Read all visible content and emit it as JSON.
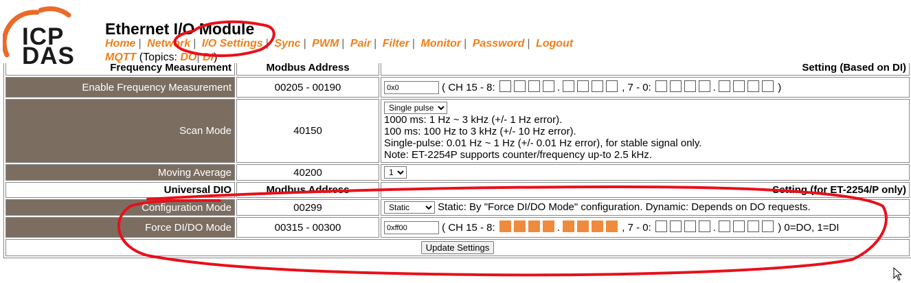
{
  "header": {
    "logo_top": "ICP",
    "logo_bottom": "DAS",
    "title": "Ethernet I/O Module",
    "nav": [
      "Home",
      "Network",
      "I/O Settings",
      "Sync",
      "PWM",
      "Pair",
      "Filter",
      "Monitor",
      "Password",
      "Logout"
    ],
    "mqtt": {
      "label": "MQTT",
      "topics_prefix": "(Topics:",
      "do": "DO",
      "di": "DI",
      "suffix": ")"
    }
  },
  "freq_header": {
    "label": "Frequency Measurement",
    "addr": "Modbus Address",
    "setting": "Setting (Based on DI)"
  },
  "rows": {
    "enable_freq": {
      "label": "Enable Frequency Measurement",
      "addr": "00205 - 00190",
      "value": "0x0",
      "ch_hi": "( CH 15 - 8:",
      "ch_lo": ", 7 - 0:",
      "tail": ")"
    },
    "scan_mode": {
      "label": "Scan Mode",
      "addr": "40150",
      "selected": "Single pulse",
      "notes": [
        "1000 ms: 1 Hz ~ 3 kHz (+/- 1 Hz error).",
        "100 ms: 100 Hz to 3 kHz (+/- 10 Hz error).",
        "Single-pulse: 0.01 Hz ~ 1 Hz (+/- 0.01 Hz error), for stable signal only.",
        "Note: ET-2254P supports counter/frequency up-to 2.5 kHz."
      ]
    },
    "moving_avg": {
      "label": "Moving Average",
      "addr": "40200",
      "selected": "1"
    }
  },
  "dio_header": {
    "label": "Universal DIO",
    "addr": "Modbus Address",
    "setting": "Setting (for ET-2254/P only)"
  },
  "dio_rows": {
    "config_mode": {
      "label": "Configuration Mode",
      "addr": "00299",
      "selected": "Static",
      "desc": "Static: By \"Force DI/DO Mode\" configuration. Dynamic: Depends on DO requests."
    },
    "force_mode": {
      "label": "Force DI/DO Mode",
      "addr": "00315 - 00300",
      "value": "0xff00",
      "ch_hi": "( CH 15 - 8:",
      "ch_lo": ", 7 - 0:",
      "tail": ") 0=DO, 1=DI"
    }
  },
  "update_button": "Update Settings",
  "colors": {
    "label_bg": "#7b6e61",
    "nav": "#ef7f1a",
    "checked": "#f08a3c",
    "annotation": "#e8101a"
  },
  "bits": {
    "enable_freq_hi": [
      0,
      0,
      0,
      0,
      0,
      0,
      0,
      0
    ],
    "enable_freq_lo": [
      0,
      0,
      0,
      0,
      0,
      0,
      0,
      0
    ],
    "force_hi": [
      1,
      1,
      1,
      1,
      1,
      1,
      1,
      1
    ],
    "force_lo": [
      0,
      0,
      0,
      0,
      0,
      0,
      0,
      0
    ]
  }
}
